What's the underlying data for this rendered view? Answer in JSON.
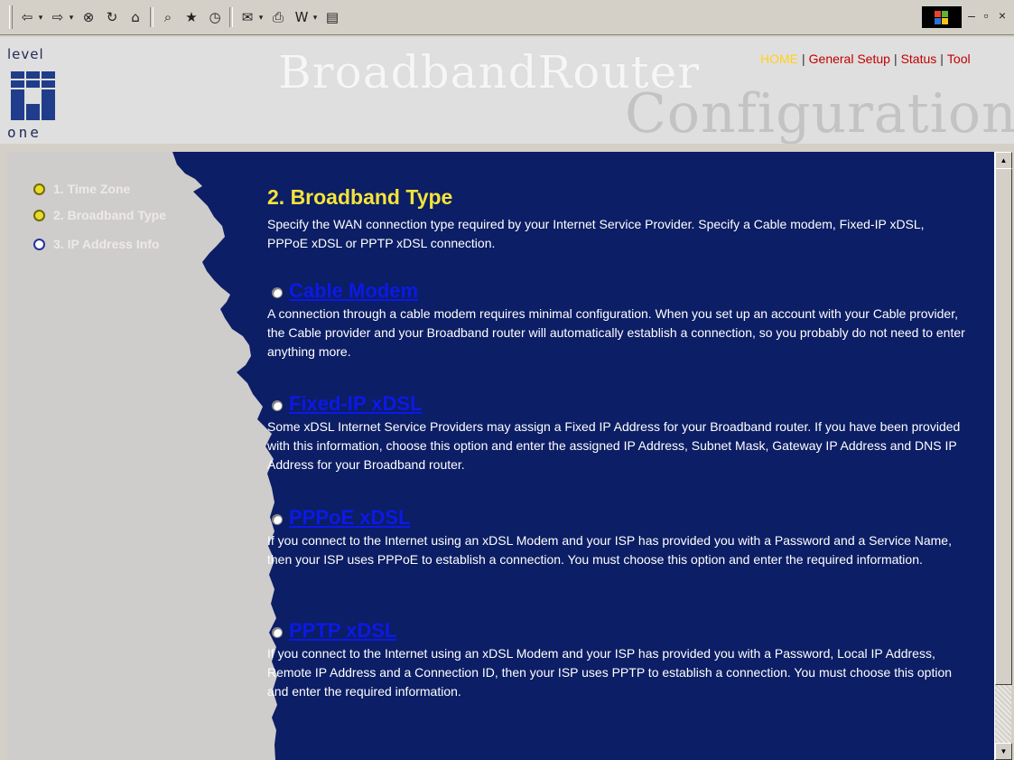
{
  "toolbar": {
    "icons": [
      "back-icon",
      "forward-icon",
      "stop-icon",
      "refresh-icon",
      "home-icon",
      "search-icon",
      "favorites-icon",
      "history-icon",
      "mail-icon",
      "print-icon",
      "edit-icon",
      "discuss-icon"
    ],
    "glyphs": {
      "back": "⇦",
      "forward": "⇨",
      "stop": "⊗",
      "refresh": "↻",
      "home": "⌂",
      "search": "⌕",
      "favorites": "★",
      "history": "◷",
      "mail": "✉",
      "print": "⎙",
      "edit": "W",
      "discuss": "▤",
      "dropdown": "▾",
      "minimize": "–",
      "restore": "▫",
      "close": "×"
    }
  },
  "header": {
    "logo_top": "level",
    "logo_bottom": "one",
    "title": "BroadbandRouter",
    "subtitle": "Configuration",
    "nav": {
      "home": "HOME",
      "separator": "|",
      "general_setup": "General Setup",
      "status": "Status",
      "tools": "Tool"
    }
  },
  "steps": [
    {
      "label": "1. Time Zone",
      "done": true
    },
    {
      "label": "2. Broadband Type",
      "done": true
    },
    {
      "label": "3. IP Address Info",
      "done": false
    }
  ],
  "main": {
    "heading": "2. Broadband Type",
    "intro": "Specify the WAN connection type required by your Internet Service Provider. Specify a Cable modem, Fixed-IP xDSL, PPPoE xDSL or PPTP xDSL connection.",
    "options": [
      {
        "title": "Cable Modem",
        "selected": false,
        "desc": "A connection through a cable modem requires minimal configuration. When you set up an account with your Cable provider, the Cable provider and your Broadband router will automatically establish a connection, so you probably do not need to enter anything more."
      },
      {
        "title": "Fixed-IP xDSL",
        "selected": false,
        "desc": "Some xDSL Internet Service Providers may assign a Fixed IP Address for your Broadband router. If you have been provided with this information, choose this option and enter the assigned IP Address, Subnet Mask, Gateway IP Address and DNS IP Address for your Broadband router."
      },
      {
        "title": "PPPoE xDSL",
        "selected": false,
        "desc": "If you connect to the Internet using an xDSL Modem and your ISP has provided you with a Password and a Service Name, then your ISP uses PPPoE to establish a connection. You must choose this option and enter the required information."
      },
      {
        "title": "PPTP xDSL",
        "selected": false,
        "desc": "If you connect to the Internet using an xDSL Modem and your ISP has provided you with a Password, Local IP Address, Remote IP Address and a Connection ID, then your ISP uses PPTP to establish a connection. You must choose this option and enter the required information."
      }
    ]
  },
  "colors": {
    "content_bg": "#0c1e65",
    "heading": "#f4e43a",
    "option_link": "#0c19e6",
    "nav_link": "#c00000",
    "nav_home": "#ffd21a",
    "sidebar_gray": "#cfcccc"
  },
  "scrollbar": {
    "up": "▲",
    "down": "▼"
  }
}
